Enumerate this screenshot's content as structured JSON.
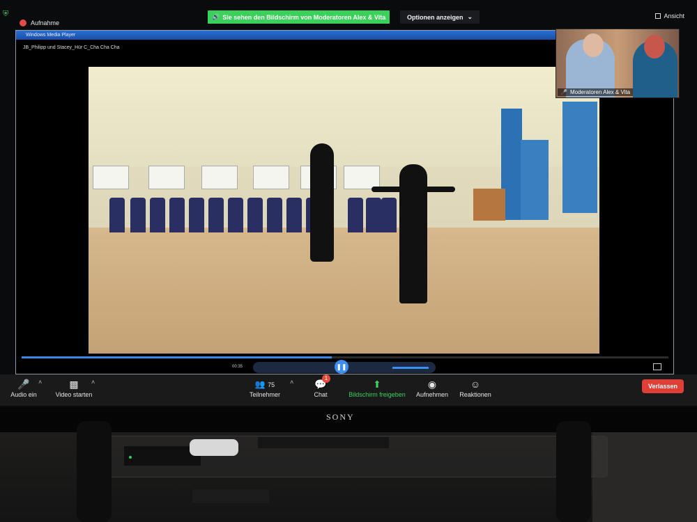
{
  "meeting": {
    "recording_label": "Aufnahme",
    "share_banner": "Sie sehen den Bildschirm von Moderatoren Alex & Vita",
    "options_label": "Optionen anzeigen",
    "view_label": "Ansicht"
  },
  "player": {
    "window_title": "Windows Media Player",
    "filename": "JB_Philipp und Stacey_Hür C_Cha Cha Cha",
    "time": "00:35",
    "progress_fraction": 0.48,
    "volume_fraction": 0.7
  },
  "participant": {
    "name": "Moderatoren Alex & Vita"
  },
  "toolbar": {
    "audio_label": "Audio ein",
    "video_label": "Video starten",
    "participants_label": "Teilnehmer",
    "participants_count": "75",
    "chat_label": "Chat",
    "chat_badge": "1",
    "share_label": "Bildschirm freigeben",
    "record_label": "Aufnehmen",
    "reactions_label": "Reaktionen",
    "leave_label": "Verlassen"
  },
  "tv": {
    "brand": "SONY"
  },
  "colors": {
    "share_green": "#3ad05a",
    "leave_red": "#df3f36",
    "accent_blue": "#3d8ef0"
  }
}
